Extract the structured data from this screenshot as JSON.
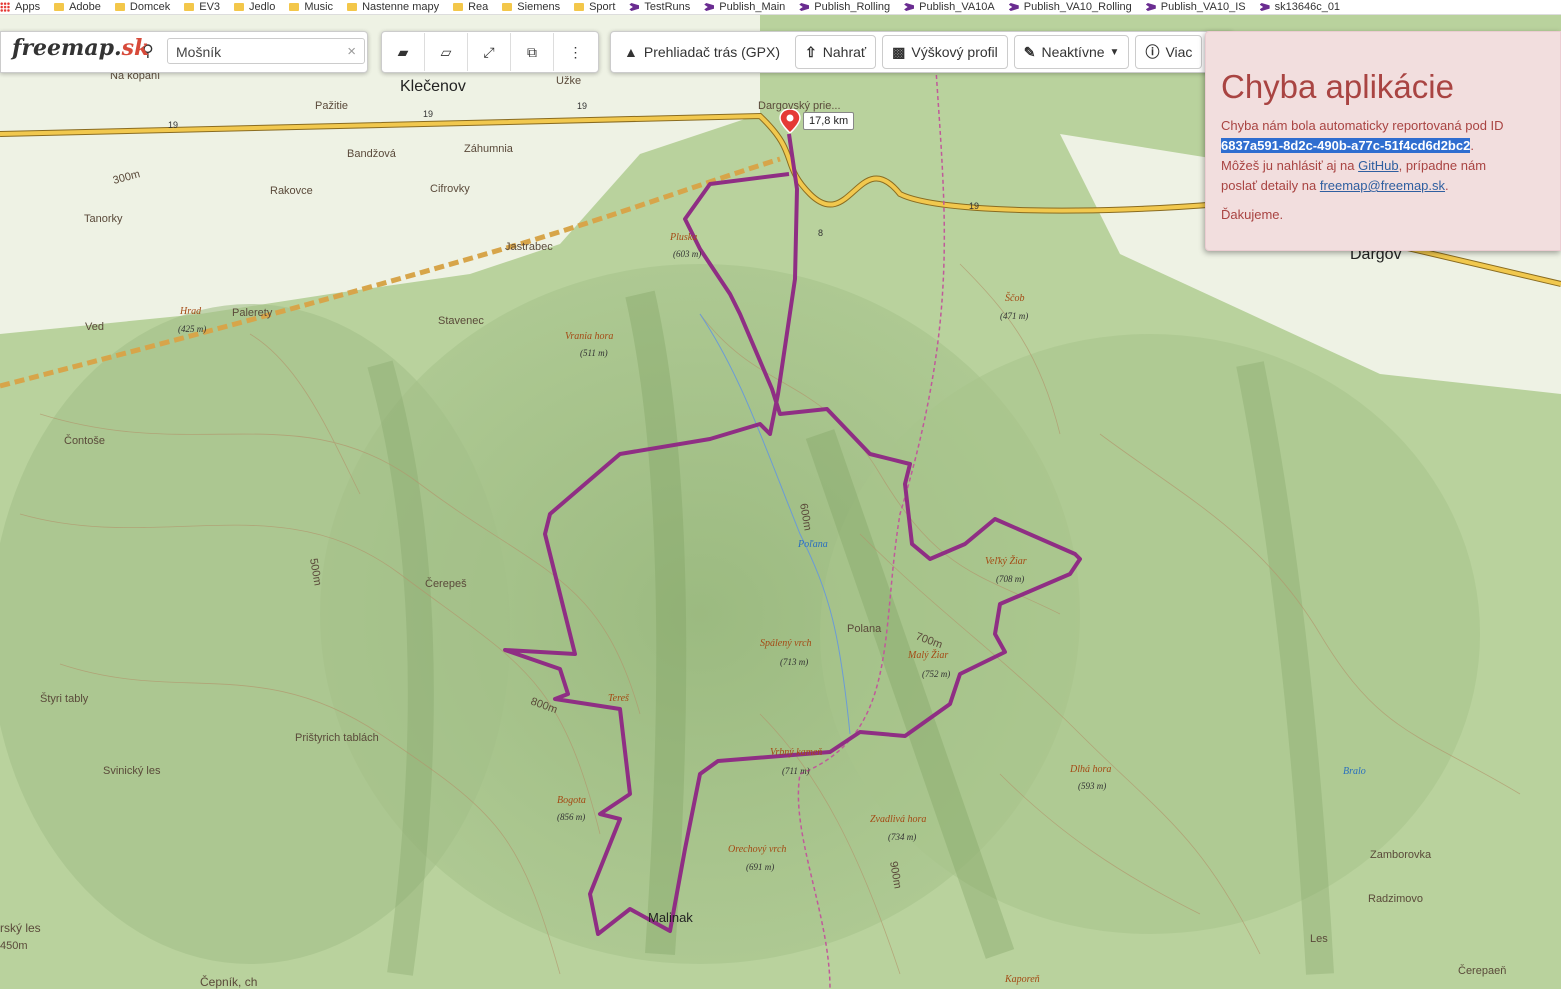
{
  "bookmarks": [
    {
      "label": "Apps",
      "icon": "apps-icon"
    },
    {
      "label": "Adobe",
      "icon": "folder-icon"
    },
    {
      "label": "Domcek",
      "icon": "folder-icon"
    },
    {
      "label": "EV3",
      "icon": "folder-icon"
    },
    {
      "label": "Jedlo",
      "icon": "folder-icon"
    },
    {
      "label": "Music",
      "icon": "folder-icon"
    },
    {
      "label": "Nastenne mapy",
      "icon": "folder-icon"
    },
    {
      "label": "Rea",
      "icon": "folder-icon"
    },
    {
      "label": "Siemens",
      "icon": "folder-icon"
    },
    {
      "label": "Sport",
      "icon": "folder-icon"
    },
    {
      "label": "TestRuns",
      "icon": "vs-icon"
    },
    {
      "label": "Publish_Main",
      "icon": "vs-icon"
    },
    {
      "label": "Publish_Rolling",
      "icon": "vs-icon"
    },
    {
      "label": "Publish_VA10A",
      "icon": "vs-icon"
    },
    {
      "label": "Publish_VA10_Rolling",
      "icon": "vs-icon"
    },
    {
      "label": "Publish_VA10_IS",
      "icon": "vs-icon"
    },
    {
      "label": "sk13646c_01",
      "icon": "vs-icon"
    }
  ],
  "logo": {
    "text_main": "freemap.",
    "text_sk": "sk"
  },
  "search": {
    "value": "Mošník",
    "clear": "×"
  },
  "toolbar": {
    "buttons": [
      {
        "name": "briefcase-button",
        "icon": "briefcase-icon",
        "glyph": "▰"
      },
      {
        "name": "eraser-button",
        "icon": "eraser-icon",
        "glyph": "▱"
      },
      {
        "name": "fullscreen-button",
        "icon": "expand-icon",
        "glyph": "⤢"
      },
      {
        "name": "open-external-button",
        "icon": "external-link-icon",
        "glyph": "⧉"
      },
      {
        "name": "more-button",
        "icon": "more-vertical-icon",
        "glyph": "⋮"
      }
    ],
    "gpx_label": "Prehliadač trás (GPX)",
    "upload_label": "Nahrať",
    "elevation_label": "Výškový profil",
    "inactive_label": "Neaktívne",
    "more_label": "Viac"
  },
  "error": {
    "title": "Chyba aplikácie",
    "line1": "Chyba nám bola automaticky reportovaná pod ID",
    "id": "6837a591-8d2c-490b-a77c-51f4cd6d2bc2",
    "line2_pre": "Môžeš ju nahlásiť aj na ",
    "github": "GitHub",
    "line2_post": ", prípadne nám",
    "line3_pre": "poslať detaily na ",
    "email": "freemap@freemap.sk",
    "line3_post": ".",
    "thanks": "Ďakujeme."
  },
  "distance": "17,8 km",
  "map_labels": {
    "towns": [
      "Klečenov",
      "Dargov"
    ],
    "places": [
      "Na kopaní",
      "Pažitie",
      "Záhumnia",
      "Bandžová",
      "Cifrovky",
      "Rakovce",
      "Tanorky",
      "Jastrabec",
      "Palerety",
      "Stavenec",
      "Ved",
      "Čontoše",
      "Čerepeš",
      "Štyri tably",
      "Svinický les",
      "Prištyrich tablách",
      "Polana",
      "Zamborovka",
      "Radzimovo",
      "Les",
      "Čerepaeň",
      "Užke",
      "Malinak",
      "Dargovský prie..."
    ],
    "peaks": [
      {
        "name": "Pluska",
        "elev": "(603 m)"
      },
      {
        "name": "Hrad",
        "elev": "(425 m)"
      },
      {
        "name": "Vrania hora",
        "elev": "(511 m)"
      },
      {
        "name": "Ščob",
        "elev": "(471 m)"
      },
      {
        "name": "Veľký Žiar",
        "elev": "(708 m)"
      },
      {
        "name": "Spálený vrch",
        "elev": "(713 m)"
      },
      {
        "name": "Malý Žiar",
        "elev": "(752 m)"
      },
      {
        "name": "Tereš",
        "elev": ""
      },
      {
        "name": "Bogota",
        "elev": "(856 m)"
      },
      {
        "name": "Orechový vrch",
        "elev": "(691 m)"
      },
      {
        "name": "Zvadlivá hora",
        "elev": "(734 m)"
      },
      {
        "name": "Dlhá hora",
        "elev": "(593 m)"
      },
      {
        "name": "Vrbný kameň",
        "elev": "(711 m)"
      },
      {
        "name": "Kaporeň",
        "elev": ""
      }
    ],
    "water": [
      "Poľana",
      "Bralo"
    ],
    "roads": [
      "19",
      "19",
      "19",
      "19",
      "8"
    ],
    "contours": [
      "500m",
      "600m",
      "700m",
      "800m",
      "900m",
      "300m"
    ],
    "other": [
      "Čepník, ch",
      "rský les",
      "450m"
    ]
  }
}
